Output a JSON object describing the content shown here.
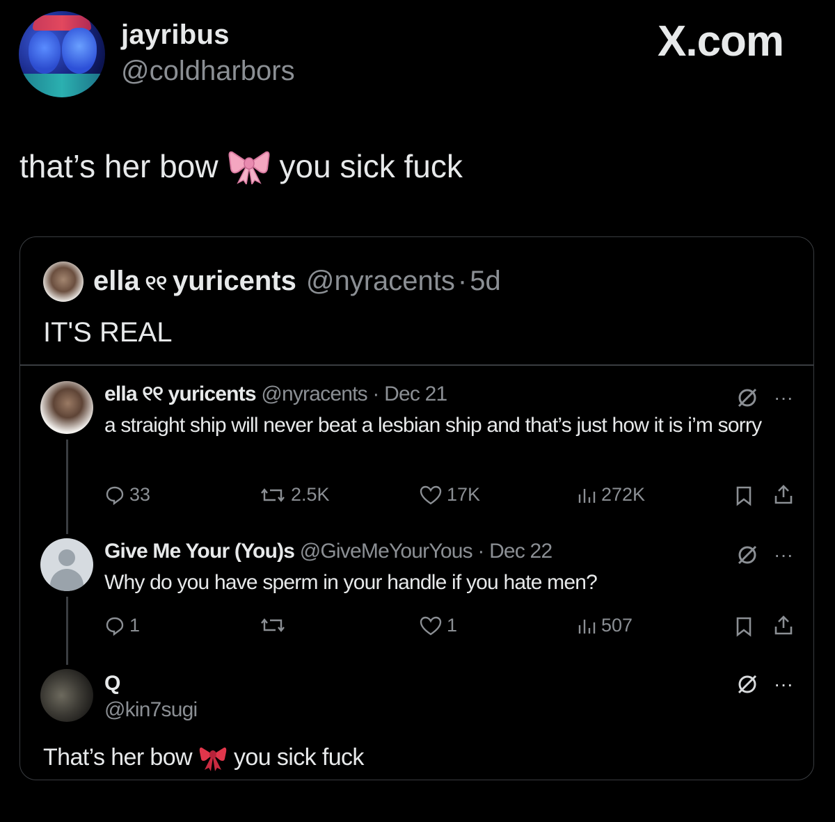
{
  "post": {
    "display_name": "jayribus",
    "handle": "@coldharbors",
    "brand": "X.com",
    "text_before": "that’s her bow",
    "emoji_icon": "ribbon-bow-emoji-pink",
    "text_after": "you sick fuck"
  },
  "quote": {
    "name": "ella",
    "name_glyph": "୧୧",
    "name_rest": "yuricents",
    "handle": "@nyracents",
    "separator": "·",
    "age": "5d",
    "text": "IT'S REAL"
  },
  "thread": [
    {
      "name": "ella ୧୧ yuricents",
      "handle": "@nyracents",
      "date": "· Dec 21",
      "body": "a straight ship will never beat a lesbian ship and that’s just how it is i’m sorry",
      "replies": "33",
      "reposts": "2.5K",
      "likes": "17K",
      "views": "272K"
    },
    {
      "name": "Give Me Your (You)s",
      "handle": "@GiveMeYourYous",
      "date": "· Dec 22",
      "body": "Why do you have sperm in your handle if you hate men?",
      "replies": "1",
      "reposts": "",
      "likes": "1",
      "views": "507"
    },
    {
      "name": "Q",
      "handle": "@kin7sugi",
      "body_before": "That’s her bow",
      "emoji_icon": "ribbon-emoji-red",
      "body_after": "you sick fuck"
    }
  ],
  "colors": {
    "background": "#000000",
    "text": "#e7e9ea",
    "muted": "#8b8f94",
    "border": "#3a3d41"
  }
}
